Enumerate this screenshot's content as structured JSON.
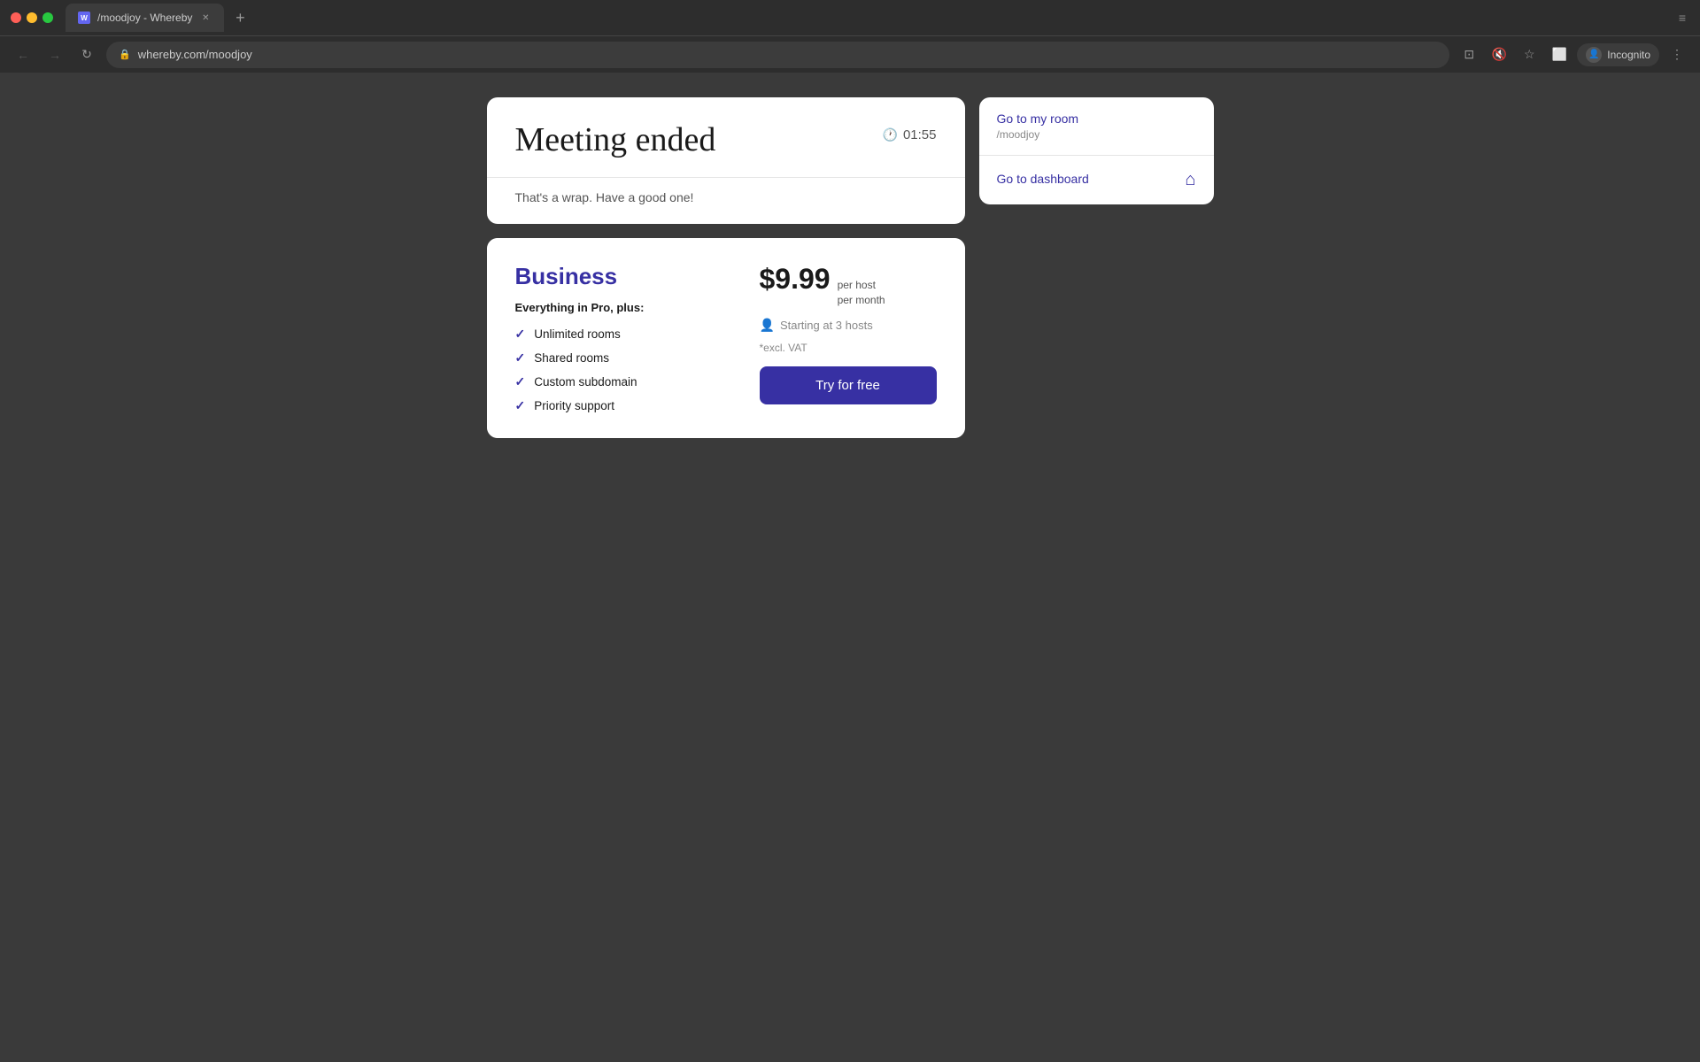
{
  "browser": {
    "tab_label": "/moodjoy - Whereby",
    "url": "whereby.com/moodjoy",
    "profile_label": "Incognito",
    "new_tab_label": "+",
    "back_tooltip": "Back",
    "forward_tooltip": "Forward",
    "refresh_tooltip": "Refresh"
  },
  "meeting_card": {
    "title": "Meeting ended",
    "duration": "01:55",
    "subtitle": "That's a wrap. Have a good one!"
  },
  "business_card": {
    "title": "Business",
    "subtitle": "Everything in Pro, plus:",
    "features": [
      "Unlimited rooms",
      "Shared rooms",
      "Custom subdomain",
      "Priority support"
    ],
    "price_amount": "$9.99",
    "price_per_host": "per host",
    "price_per_month": "per month",
    "hosts_label": "Starting at 3 hosts",
    "vat_note": "*excl. VAT",
    "try_free_label": "Try for free"
  },
  "side_panel": {
    "go_to_room_label": "Go to my room",
    "room_name": "/moodjoy",
    "go_to_dashboard_label": "Go to dashboard"
  }
}
